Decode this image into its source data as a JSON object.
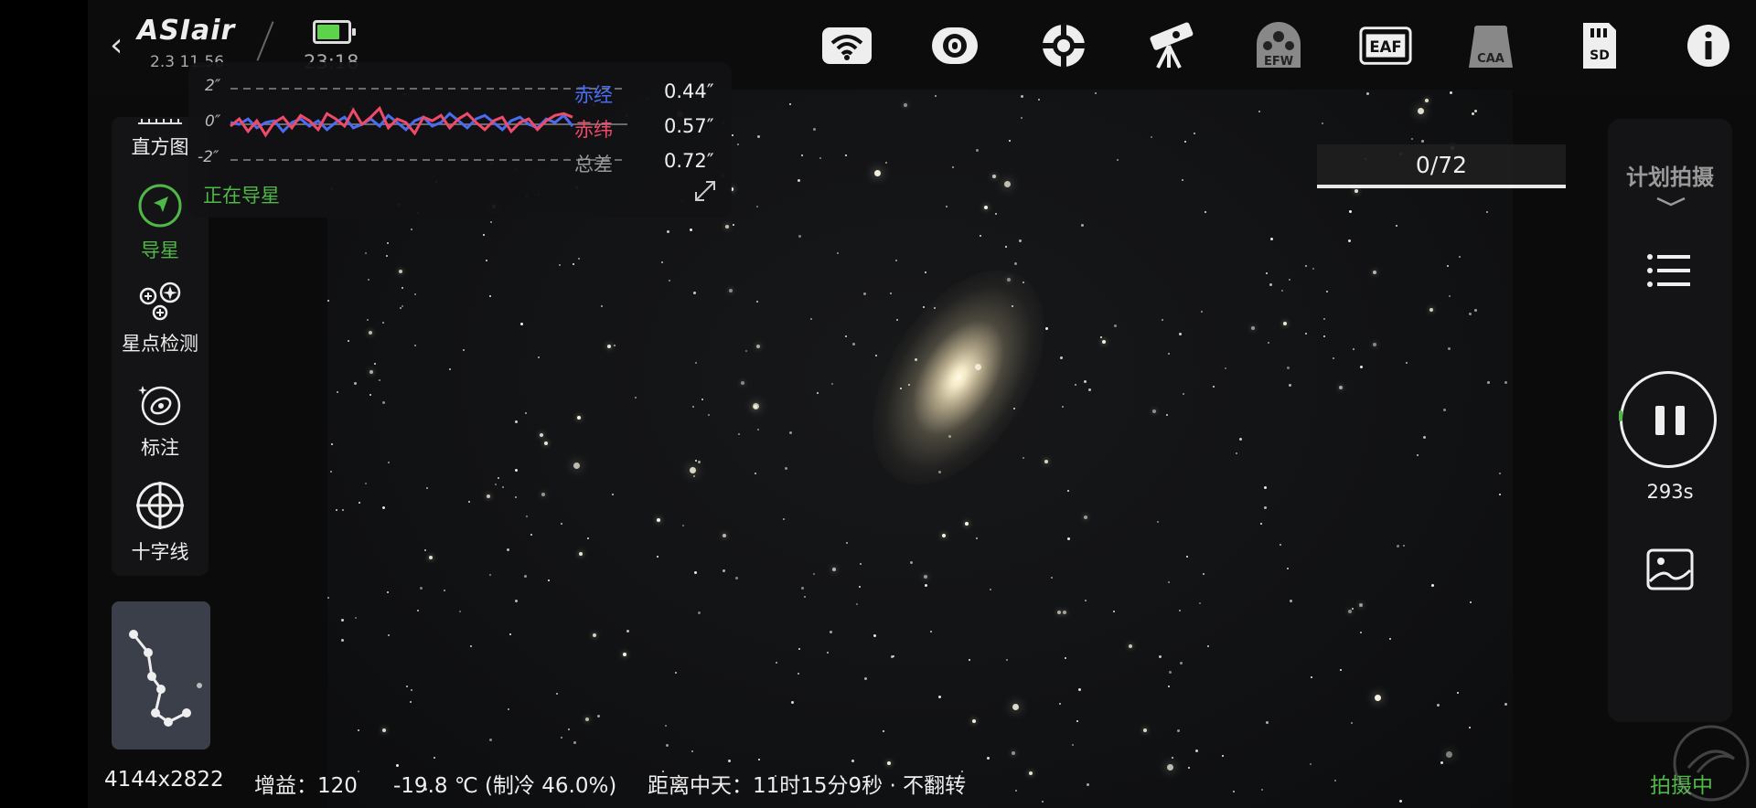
{
  "header": {
    "back_glyph": "‹",
    "logo": "ASIair",
    "version": "2.3 11.56",
    "time": "23:18",
    "battery_level": 0.75,
    "toolbar_icons": [
      "wifi-icon",
      "camera-icon",
      "guide-scope-icon",
      "telescope-mount-icon",
      "efw-icon",
      "eaf-icon",
      "caa-icon",
      "sd-card-icon",
      "info-icon"
    ],
    "efw_label": "EFW",
    "eaf_label": "EAF",
    "caa_label": "CAA",
    "sd_label": "SD"
  },
  "left_tools": {
    "histogram": "直方图",
    "guide": "导星",
    "star_detect": "星点检测",
    "annotate": "标注",
    "crosshair": "十字线"
  },
  "guide_panel": {
    "ticks": [
      "2″",
      "0″",
      "-2″"
    ],
    "ra_label": "赤经",
    "ra_value": "0.44″",
    "dec_label": "赤纬",
    "dec_value": "0.57″",
    "total_label": "总差",
    "total_value": "0.72″",
    "status": "正在导星",
    "ra_color": "#4a6cf0",
    "dec_color": "#f04a6a",
    "ra_trace": [
      0.1,
      0.0,
      0.3,
      -0.2,
      0.1,
      0.2,
      -0.4,
      0.1,
      0.3,
      -0.1,
      0.2,
      -0.3,
      0.1,
      0.4,
      -0.2,
      0.0,
      0.3,
      -0.1,
      0.5,
      0.1,
      -0.3,
      0.2,
      0.4,
      -0.1,
      0.1,
      0.6,
      0.2,
      -0.2,
      0.3,
      0.5,
      0.1,
      -0.3,
      0.2,
      0.4,
      0.0,
      -0.2,
      0.3,
      0.1,
      0.5,
      -0.1
    ],
    "dec_trace": [
      -0.1,
      0.3,
      -0.4,
      0.2,
      -0.6,
      0.1,
      0.4,
      -0.2,
      0.5,
      0.2,
      -0.3,
      0.6,
      0.3,
      -0.1,
      0.8,
      0.0,
      0.4,
      0.9,
      -0.2,
      0.3,
      0.1,
      -0.5,
      0.4,
      0.2,
      0.5,
      -0.2,
      0.3,
      0.6,
      0.1,
      -0.3,
      0.2,
      0.4,
      -0.4,
      0.1,
      0.3,
      -0.3,
      0.2,
      0.5,
      0.6,
      0.4
    ]
  },
  "sequence": {
    "progress_text": "0/72",
    "progress_fraction": 0.0,
    "plan_label": "计划拍摄",
    "exposure_remaining": "293s"
  },
  "status_bar": {
    "resolution": "4144x2822",
    "gain": "增益：120",
    "temperature": "-19.8 ℃ (制冷 46.0%)",
    "meridian": "距离中天：11时15分9秒 · 不翻转",
    "state": "拍摄中"
  }
}
